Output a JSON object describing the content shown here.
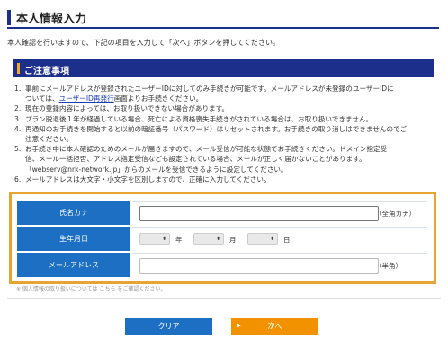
{
  "page": {
    "title": "本人情報入力",
    "intro": "本人確認を行いますので、下記の項目を入力して「次へ」ボタンを押してください。"
  },
  "notice": {
    "heading": "ご注意事項",
    "items": [
      {
        "num": "1.",
        "line1": "事前にメールアドレスが登録されたユーザーIDに対してのみ手続きが可能です。メールアドレスが未登録のユーザーIDに",
        "line2_pre": "ついては、",
        "link": "ユーザーID再発行",
        "line2_post": "画面よりお手続きください。"
      },
      {
        "num": "2.",
        "text": "現在の登録内容によっては、お取り扱いできない場合があります。"
      },
      {
        "num": "3.",
        "text": "プラン脱退後１年が経過している場合、死亡による資格喪失手続きがされている場合は、お取り扱いできません。"
      },
      {
        "num": "4.",
        "line1": "再通知のお手続きを開始すると以前の暗証番号（パスワード）はリセットされます。お手続きの取り消しはできませんのでご",
        "line2": "注意ください。"
      },
      {
        "num": "5.",
        "line1": "お手続き中に本人確認のためのメールが届きますので、メール受信が可能な状態でお手続きください。ドメイン指定受",
        "line2": "信、メール一括拒否、アドレス指定受信なども設定されている場合、メールが正しく届かないことがあります。",
        "line3": "「webserv@nrk-network.jp」からのメールを受信できるように設定してください。"
      },
      {
        "num": "6.",
        "text": "メールアドレスは大文字・小文字を区別しますので、正確に入力してください。"
      }
    ]
  },
  "form": {
    "name_kana": {
      "label": "氏名カナ",
      "value": "",
      "hint": "（全角カナ）"
    },
    "birthdate": {
      "label": "生年月日",
      "year": "",
      "year_unit": "年",
      "month": "",
      "month_unit": "月",
      "day": "",
      "day_unit": "日"
    },
    "email": {
      "label": "メールアドレス",
      "value": "",
      "hint": "（半角）"
    }
  },
  "below_note": "※ 個人情報の取り扱いについては こちら をご確認ください。",
  "buttons": {
    "clear": "クリア",
    "next": "次へ"
  },
  "colors": {
    "navy": "#1c2f8a",
    "label_blue": "#1d6fc4",
    "highlight_orange": "#e8a430",
    "next_orange": "#f39200"
  }
}
